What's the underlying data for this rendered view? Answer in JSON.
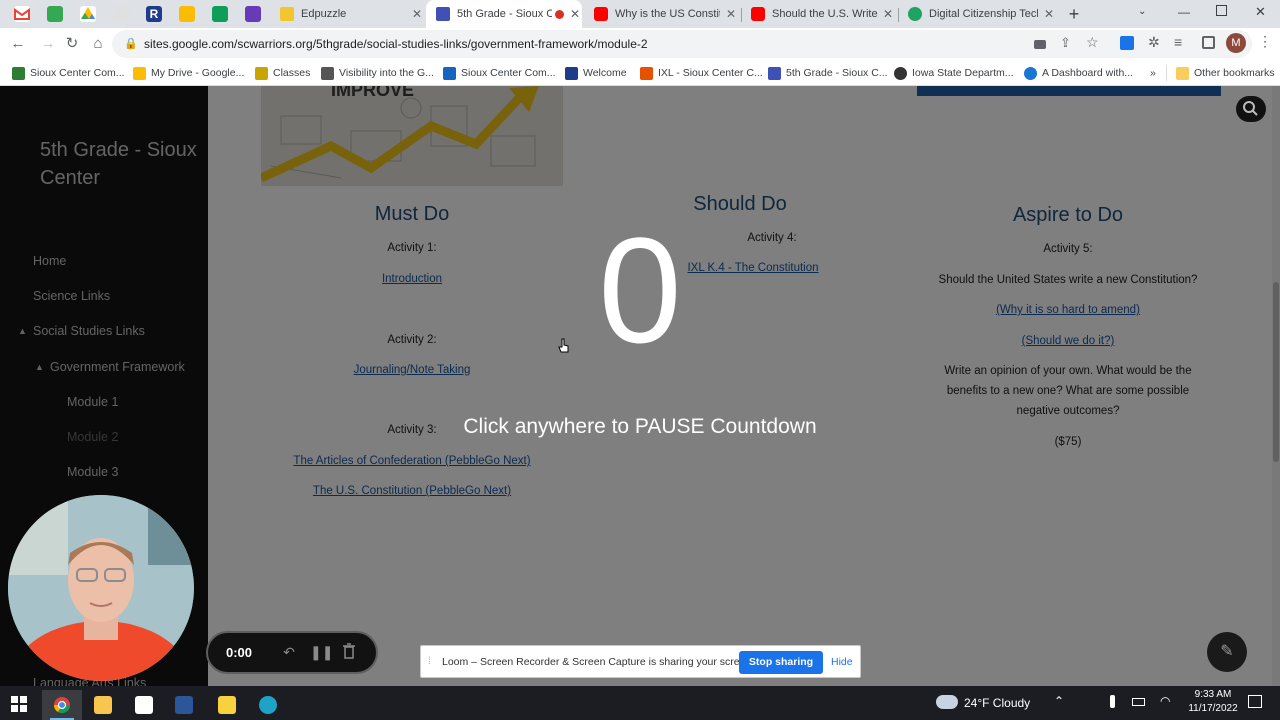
{
  "browser": {
    "tabs": [
      {
        "title": "Edpuzzle",
        "icon": "edpuzzle-icon",
        "color": "#f3c52f"
      },
      {
        "title": "5th Grade - Sioux C",
        "icon": "google-sites-icon",
        "color": "#3f51b5",
        "recording": true
      },
      {
        "title": "Why is the US Constitu",
        "icon": "youtube-icon",
        "color": "#ff0000"
      },
      {
        "title": "Should the U.S. Write a",
        "icon": "youtube-icon",
        "color": "#ff0000"
      },
      {
        "title": "Digital Citizenship Tech",
        "icon": "pearson-icon",
        "color": "#1ea362"
      }
    ],
    "new_tab": "+",
    "url": "sites.google.com/scwarriors.org/5thgrade/social-studies-links/government-framework/module-2",
    "profile_initial": "M",
    "bookmarks": [
      {
        "label": "Sioux Center Com...",
        "color": "#2e7d32"
      },
      {
        "label": "My Drive - Google...",
        "color": "#fbbc04"
      },
      {
        "label": "Classes",
        "color": "#c8a500"
      },
      {
        "label": "Visibility into the G...",
        "color": "#555555"
      },
      {
        "label": "Sioux Center Com...",
        "color": "#1565c0"
      },
      {
        "label": "Welcome",
        "color": "#1f3c88"
      },
      {
        "label": "IXL - Sioux Center C...",
        "color": "#e65100"
      },
      {
        "label": "5th Grade - Sioux C...",
        "color": "#3f51b5"
      },
      {
        "label": "Iowa State Departm...",
        "color": "#333333"
      },
      {
        "label": "A Dashboard with...",
        "color": "#1976d2"
      }
    ],
    "bookmarks_more": "»",
    "other_bookmarks": "Other bookmarks"
  },
  "site": {
    "title": "5th Grade - Sioux Center",
    "nav": [
      {
        "label": "Home"
      },
      {
        "label": "Science Links"
      },
      {
        "label": "Social Studies Links"
      },
      {
        "label": "Government Framework"
      },
      {
        "label": "Module 1"
      },
      {
        "label": "Module 2"
      },
      {
        "label": "Module 3"
      },
      {
        "label": "Language Arts Links"
      }
    ],
    "columns": {
      "must": {
        "heading": "Must Do",
        "activity1": "Activity 1:",
        "link1": "Introduction",
        "activity2": "Activity 2:",
        "link2": "Journaling/Note Taking",
        "activity3": "Activity 3:",
        "link3a": "The Articles of Confederation (PebbleGo Next)",
        "link3b": "The U.S. Constitution (PebbleGo Next)"
      },
      "should": {
        "heading": "Should Do",
        "activity4": "Activity 4:",
        "link4": "IXL K.4 - The Constitution"
      },
      "aspire": {
        "heading": "Aspire to Do",
        "activity5": "Activity 5:",
        "question": "Should the United States write a new Constitution?",
        "link5a": "(Why it is so hard to amend)",
        "link5b": "(Should we do it?)",
        "prompt": "Write an opinion of your own.  What would be the benefits to a new one?  What are some possible negative outcomes?",
        "reward": "($75)"
      }
    }
  },
  "countdown": {
    "number": "0",
    "message": "Click anywhere to PAUSE Countdown"
  },
  "loom": {
    "time": "0:00",
    "share_message": "Loom – Screen Recorder & Screen Capture is sharing your screen.",
    "stop_label": "Stop sharing",
    "hide_label": "Hide"
  },
  "taskbar": {
    "weather": "24°F  Cloudy",
    "time": "9:33 AM",
    "date": "11/17/2022"
  },
  "colors": {
    "heading_blue": "#1f4e79",
    "link_blue": "#1a56a0",
    "stop_button": "#1a73e8"
  }
}
